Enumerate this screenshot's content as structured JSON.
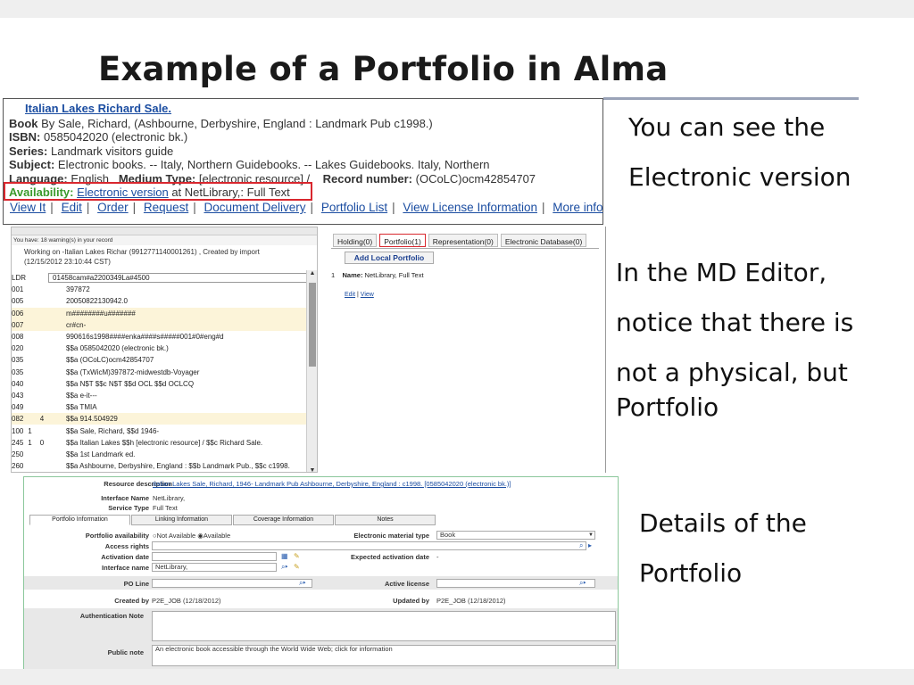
{
  "slide": {
    "title": "Example of a Portfolio in Alma",
    "notes": [
      "You can see the",
      "Electronic version",
      "In the MD Editor,",
      "notice that there is",
      "not a physical, but",
      "Portfolio",
      "Details of the",
      "Portfolio"
    ]
  },
  "record": {
    "title": "Italian Lakes Richard Sale.",
    "book_label": "Book",
    "book_value": " By Sale, Richard, (Ashbourne, Derbyshire, England : Landmark Pub c1998.)",
    "isbn_label": "ISBN:",
    "isbn_value": " 0585042020 (electronic bk.)",
    "series_label": "Series:",
    "series_value": " Landmark visitors guide",
    "subject_label": "Subject:",
    "subject_value": " Electronic books. -- Italy, Northern Guidebooks. -- Lakes Guidebooks. Italy, Northern",
    "language_label": "Language:",
    "language_value": " English",
    "medium_label": "Medium Type:",
    "medium_value": " [electronic resource] /",
    "recnum_label": "Record number:",
    "recnum_value": " (OCoLC)ocm42854707",
    "availability_label": "Availability:",
    "availability_link": "Electronic version",
    "availability_rest": " at NetLibrary,: Full Text",
    "links": [
      "View It",
      "Edit",
      "Order",
      "Request",
      "Document Delivery",
      "Portfolio List",
      "View License Information",
      "More info"
    ]
  },
  "md_editor": {
    "warning": "You have: 18 warning(s) in your record",
    "working_on": "Working on -Italian Lakes Richar (9912771140001261) , Created by import",
    "working_date": "(12/15/2012 23:10:44 CST)",
    "fields": [
      {
        "tag": "LDR",
        "i1": "",
        "i2": "",
        "value": "01458cam#a2200349La#4500",
        "hl": false,
        "ldr": true
      },
      {
        "tag": "001",
        "i1": "",
        "i2": "",
        "value": "397872",
        "hl": false
      },
      {
        "tag": "005",
        "i1": "",
        "i2": "",
        "value": "20050822130942.0",
        "hl": false
      },
      {
        "tag": "006",
        "i1": "",
        "i2": "",
        "value": "m########u#######",
        "hl": true
      },
      {
        "tag": "007",
        "i1": "",
        "i2": "",
        "value": "cr#cn-",
        "hl": true
      },
      {
        "tag": "008",
        "i1": "",
        "i2": "",
        "value": "990616s1998####enka####s#####001#0#eng#d",
        "hl": false
      },
      {
        "tag": "020",
        "i1": "",
        "i2": "",
        "value": "$$a 0585042020 (electronic bk.)",
        "hl": false
      },
      {
        "tag": "035",
        "i1": "",
        "i2": "",
        "value": "$$a (OCoLC)ocm42854707",
        "hl": false
      },
      {
        "tag": "035",
        "i1": "",
        "i2": "",
        "value": "$$a (TxWicM)397872-midwestdb-Voyager",
        "hl": false
      },
      {
        "tag": "040",
        "i1": "",
        "i2": "",
        "value": "$$a N$T $$c N$T $$d OCL $$d OCLCQ",
        "hl": false
      },
      {
        "tag": "043",
        "i1": "",
        "i2": "",
        "value": "$$a e-it---",
        "hl": false
      },
      {
        "tag": "049",
        "i1": "",
        "i2": "",
        "value": "$$a TMIA",
        "hl": false
      },
      {
        "tag": "082",
        "i1": "",
        "i2": "4",
        "value": "$$a 914.504929",
        "hl": true
      },
      {
        "tag": "100",
        "i1": "1",
        "i2": "",
        "value": "$$a Sale, Richard, $$d 1946-",
        "hl": false
      },
      {
        "tag": "245",
        "i1": "1",
        "i2": "0",
        "value": "$$a Italian Lakes $$h [electronic resource] / $$c Richard Sale.",
        "hl": false
      },
      {
        "tag": "250",
        "i1": "",
        "i2": "",
        "value": "$$a 1st Landmark ed.",
        "hl": false
      },
      {
        "tag": "260",
        "i1": "",
        "i2": "",
        "value": "$$a Ashbourne, Derbyshire, England : $$b Landmark Pub., $$c c1998.",
        "hl": false
      }
    ]
  },
  "holdings": {
    "tabs": [
      "Holding(0)",
      "Portfolio(1)",
      "Representation(0)",
      "Electronic Database(0)"
    ],
    "add_button": "Add Local Portfolio",
    "item_number": "1",
    "name_label": "Name:",
    "name_value": " NetLibrary, Full Text",
    "edit": "Edit",
    "view": "View"
  },
  "portfolio": {
    "resource_label": "Resource description",
    "resource_value": "Italian Lakes Sale, Richard, 1946- Landmark Pub Ashbourne, Derbyshire, England : c1998. [0585042020 (electronic bk.)]",
    "interface_name_label": "Interface Name",
    "interface_name_value": "NetLibrary,",
    "service_type_label": "Service Type",
    "service_type_value": "Full Text",
    "tabs": [
      "Portfolio Information",
      "Linking Information",
      "Coverage Information",
      "Notes"
    ],
    "availability_label": "Portfolio availability",
    "opt_not_available": "Not Available",
    "opt_available": "Available",
    "material_type_label": "Electronic material type",
    "material_type_value": "Book",
    "access_rights_label": "Access rights",
    "activation_date_label": "Activation date",
    "expected_activation_label": "Expected activation date",
    "expected_activation_value": "-",
    "interface_label": "Interface name",
    "interface_value": "NetLibrary,",
    "po_line_label": "PO Line",
    "active_license_label": "Active license",
    "created_by_label": "Created by",
    "created_by_value": "P2E_JOB (12/18/2012)",
    "updated_by_label": "Updated by",
    "updated_by_value": "P2E_JOB (12/18/2012)",
    "auth_note_label": "Authentication Note",
    "public_note_label": "Public note",
    "public_note_value": "An electronic book accessible through the World Wide Web; click for information"
  }
}
